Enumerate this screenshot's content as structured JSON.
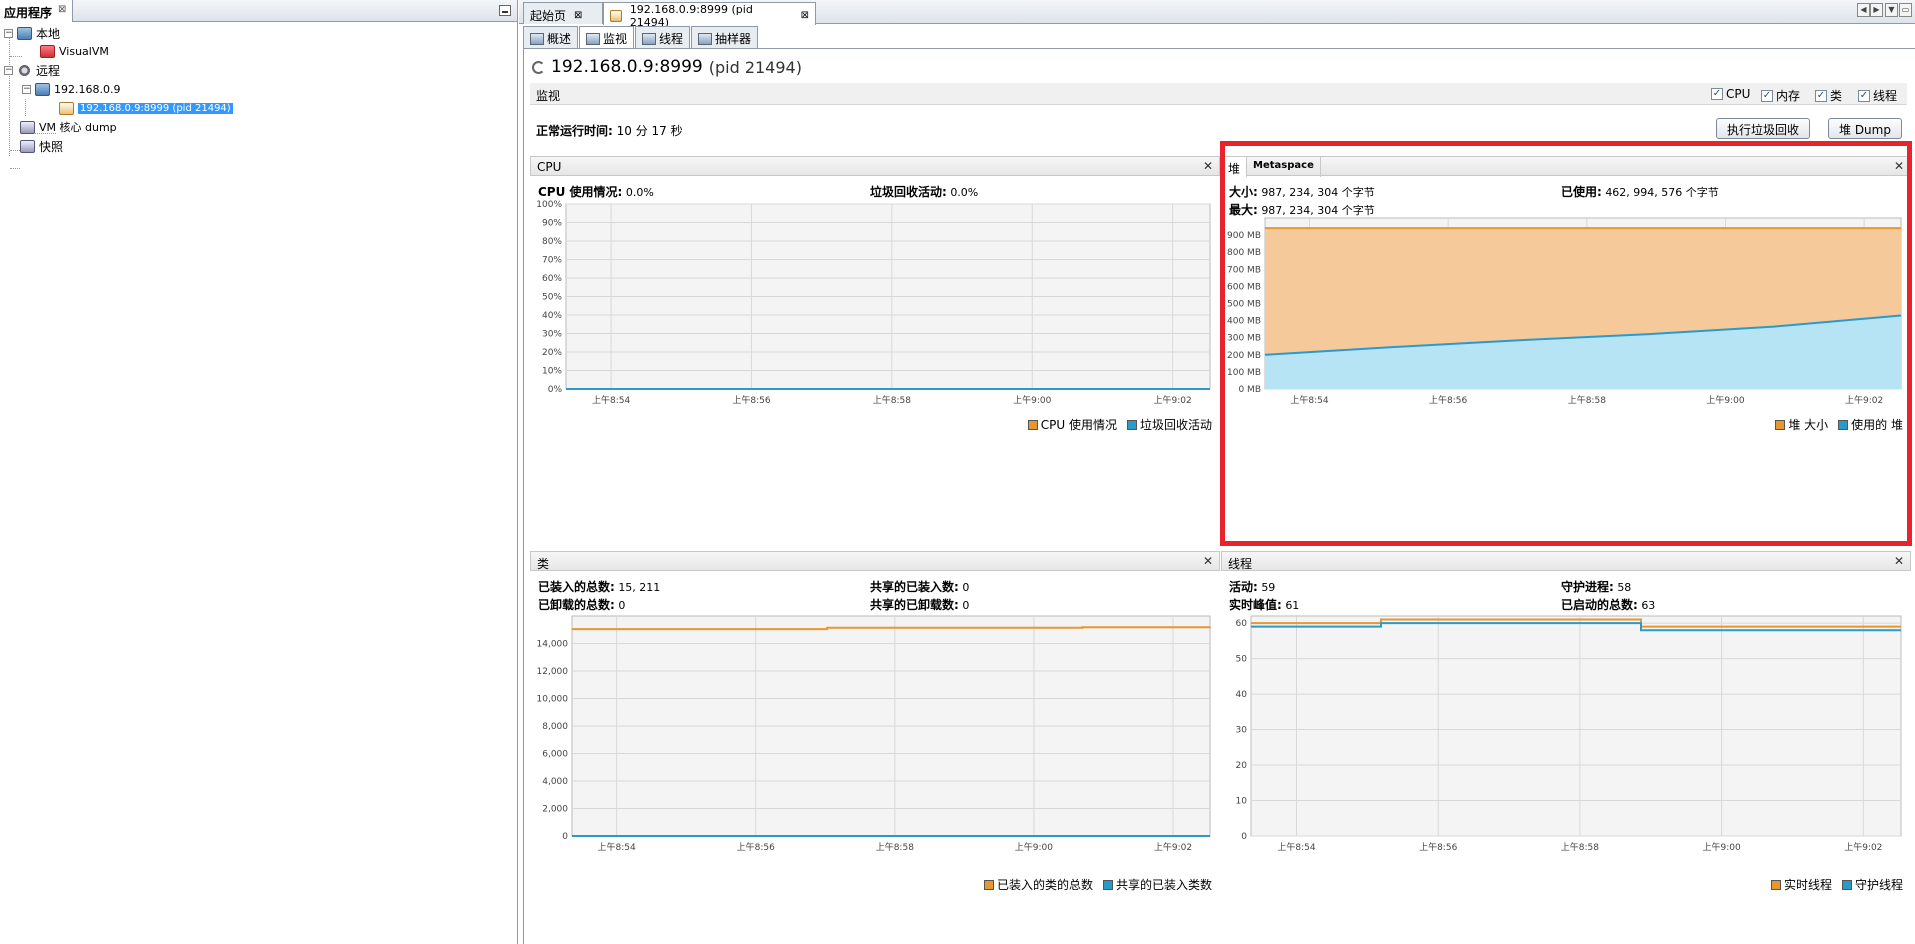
{
  "left_panel": {
    "tab_title": "应用程序",
    "tree": [
      {
        "label": "本地",
        "icon": "computer-icon",
        "level": 0
      },
      {
        "label": "VisualVM",
        "icon": "visualvm-icon",
        "level": 1
      },
      {
        "label": "远程",
        "icon": "network-icon",
        "level": 0
      },
      {
        "label": "192.168.0.9",
        "icon": "host-icon",
        "level": 1
      },
      {
        "label": "192.168.0.9:8999 (pid 21494)",
        "icon": "java-app-icon",
        "level": 2,
        "selected": true
      },
      {
        "label": "VM 核心 dump",
        "icon": "coredump-icon",
        "level": 0
      },
      {
        "label": "快照",
        "icon": "snapshot-icon",
        "level": 0
      }
    ]
  },
  "doc_tabs": [
    {
      "label": "起始页"
    },
    {
      "label": "192.168.0.9:8999 (pid 21494)",
      "active": true
    }
  ],
  "sub_tabs": [
    {
      "label": "概述"
    },
    {
      "label": "监视",
      "active": true
    },
    {
      "label": "线程"
    },
    {
      "label": "抽样器"
    }
  ],
  "header": {
    "title": "192.168.0.9:8999",
    "pid": "(pid 21494)"
  },
  "monitor": {
    "label": "监视",
    "checkboxes": [
      "CPU",
      "内存",
      "类",
      "线程"
    ],
    "uptime_label": "正常运行时间:",
    "uptime_value": "10 分 17 秒",
    "gc_button": "执行垃圾回收",
    "dump_button": "堆 Dump"
  },
  "cpu": {
    "title": "CPU",
    "usage_label": "CPU 使用情况:",
    "usage_value": "0.0%",
    "gc_label": "垃圾回收活动:",
    "gc_value": "0.0%",
    "legend": [
      "CPU 使用情况",
      "垃圾回收活动"
    ]
  },
  "heap": {
    "tabs": [
      "堆",
      "Metaspace"
    ],
    "size_label": "大小:",
    "size_value": "987, 234, 304 个字节",
    "max_label": "最大:",
    "max_value": "987, 234, 304 个字节",
    "used_label": "已使用:",
    "used_value": "462, 994, 576 个字节",
    "legend": [
      "堆 大小",
      "使用的 堆"
    ]
  },
  "classes": {
    "title": "类",
    "loaded_label": "已装入的总数:",
    "loaded_value": "15, 211",
    "unloaded_label": "已卸载的总数:",
    "unloaded_value": "0",
    "shared_loaded_label": "共享的已装入数:",
    "shared_loaded_value": "0",
    "shared_unloaded_label": "共享的已卸载数:",
    "shared_unloaded_value": "0",
    "legend": [
      "已装入的类的总数",
      "共享的已装入类数"
    ]
  },
  "threads": {
    "title": "线程",
    "live_label": "活动:",
    "live_value": "59",
    "daemon_label": "守护进程:",
    "daemon_value": "58",
    "peak_label": "实时峰值:",
    "peak_value": "61",
    "started_label": "已启动的总数:",
    "started_value": "63",
    "legend": [
      "实时线程",
      "守护线程"
    ]
  },
  "colors": {
    "orange": "#e8962e",
    "blue": "#2b9ac9",
    "heap_fill": "#f5c99a",
    "used_fill": "#b6e4f5"
  },
  "chart_data": [
    {
      "type": "line",
      "name": "cpu",
      "x": [
        "上午8:54",
        "上午8:56",
        "上午8:58",
        "上午9:00",
        "上午9:02"
      ],
      "ylim": [
        0,
        100
      ],
      "yticks": [
        "0%",
        "10%",
        "20%",
        "30%",
        "40%",
        "50%",
        "60%",
        "70%",
        "80%",
        "90%",
        "100%"
      ],
      "series": [
        {
          "name": "CPU 使用情况",
          "values": [
            0,
            0,
            0,
            0,
            0
          ]
        },
        {
          "name": "垃圾回收活动",
          "values": [
            0,
            0,
            0,
            0,
            0
          ]
        }
      ]
    },
    {
      "type": "area",
      "name": "heap",
      "x": [
        "上午8:54",
        "上午8:56",
        "上午8:58",
        "上午9:00",
        "上午9:02"
      ],
      "ylim": [
        0,
        1000
      ],
      "yticks": [
        "0 MB",
        "100 MB",
        "200 MB",
        "300 MB",
        "400 MB",
        "500 MB",
        "600 MB",
        "700 MB",
        "800 MB",
        "900 MB"
      ],
      "series": [
        {
          "name": "堆 大小",
          "values": [
            941,
            941,
            941,
            941,
            941,
            941
          ]
        },
        {
          "name": "使用的 堆",
          "values": [
            200,
            245,
            285,
            320,
            365,
            430
          ]
        }
      ]
    },
    {
      "type": "line",
      "name": "classes",
      "x": [
        "上午8:54",
        "上午8:56",
        "上午8:58",
        "上午9:00",
        "上午9:02"
      ],
      "ylim": [
        0,
        16000
      ],
      "yticks": [
        "0",
        "2,000",
        "4,000",
        "6,000",
        "8,000",
        "10,000",
        "12,000",
        "14,000"
      ],
      "series": [
        {
          "name": "已装入的类的总数",
          "values": [
            15050,
            15050,
            15150,
            15150,
            15180,
            15211
          ]
        },
        {
          "name": "共享的已装入类数",
          "values": [
            0,
            0,
            0,
            0,
            0,
            0
          ]
        }
      ]
    },
    {
      "type": "line",
      "name": "threads",
      "x": [
        "上午8:54",
        "上午8:56",
        "上午8:58",
        "上午9:00",
        "上午9:02"
      ],
      "ylim": [
        0,
        62
      ],
      "yticks": [
        "0",
        "10",
        "20",
        "30",
        "40",
        "50",
        "60"
      ],
      "series": [
        {
          "name": "实时线程",
          "values": [
            60,
            61,
            61,
            59,
            59,
            59
          ]
        },
        {
          "name": "守护线程",
          "values": [
            59,
            60,
            60,
            58,
            58,
            58
          ]
        }
      ]
    }
  ]
}
